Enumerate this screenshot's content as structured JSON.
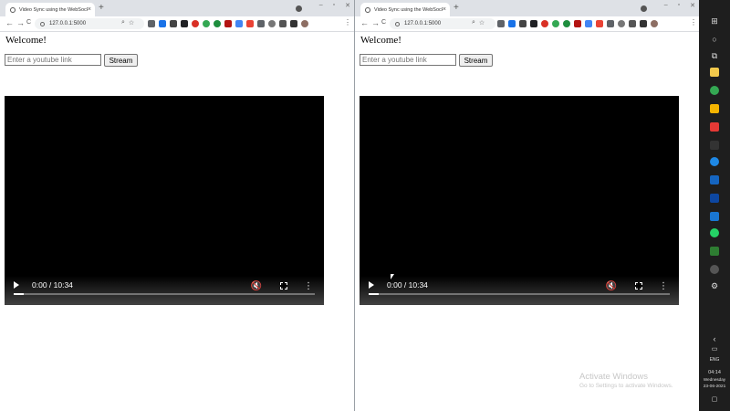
{
  "browser": {
    "tab_title": "Video Sync using the WebSocket",
    "tab_close": "×",
    "new_tab": "+",
    "url": "127.0.0.1:5000",
    "back_glyph": "←",
    "forward_glyph": "→",
    "reload_glyph": "C",
    "star_glyph": "☆",
    "menu_glyph": "⋮"
  },
  "page": {
    "welcome": "Welcome!",
    "link_placeholder": "Enter a youtube link",
    "stream_label": "Stream"
  },
  "video": {
    "time": "0:00 / 10:34",
    "mute_glyph": "🔇",
    "more_glyph": "⋮",
    "progress_fraction": 0.034
  },
  "os": {
    "watermark_title": "Activate Windows",
    "watermark_sub": "Go to Settings to activate Windows.",
    "lang": "ENG",
    "time": "04:14",
    "day": "Wednesday",
    "date": "23-06-2021"
  },
  "colors": {
    "tabstrip": "#dee1e6",
    "taskbar": "#1e1e1e"
  }
}
